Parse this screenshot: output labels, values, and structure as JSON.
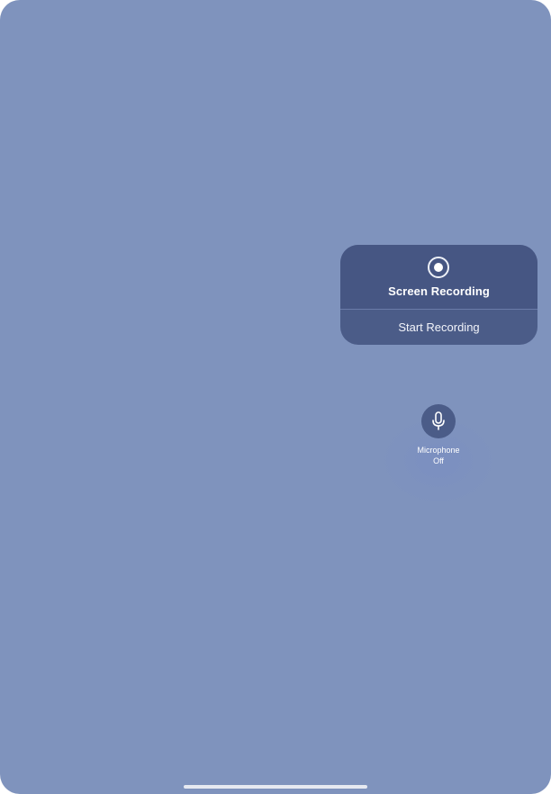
{
  "screen_recording": {
    "title": "Screen Recording",
    "action_label": "Start Recording",
    "icon": "record-icon"
  },
  "microphone": {
    "label": "Microphone",
    "status": "Off",
    "icon": "microphone-icon"
  },
  "colors": {
    "background": "#7f93bd",
    "panel": "#465683",
    "panel_button": "#4b5c88",
    "text": "#ffffff"
  }
}
